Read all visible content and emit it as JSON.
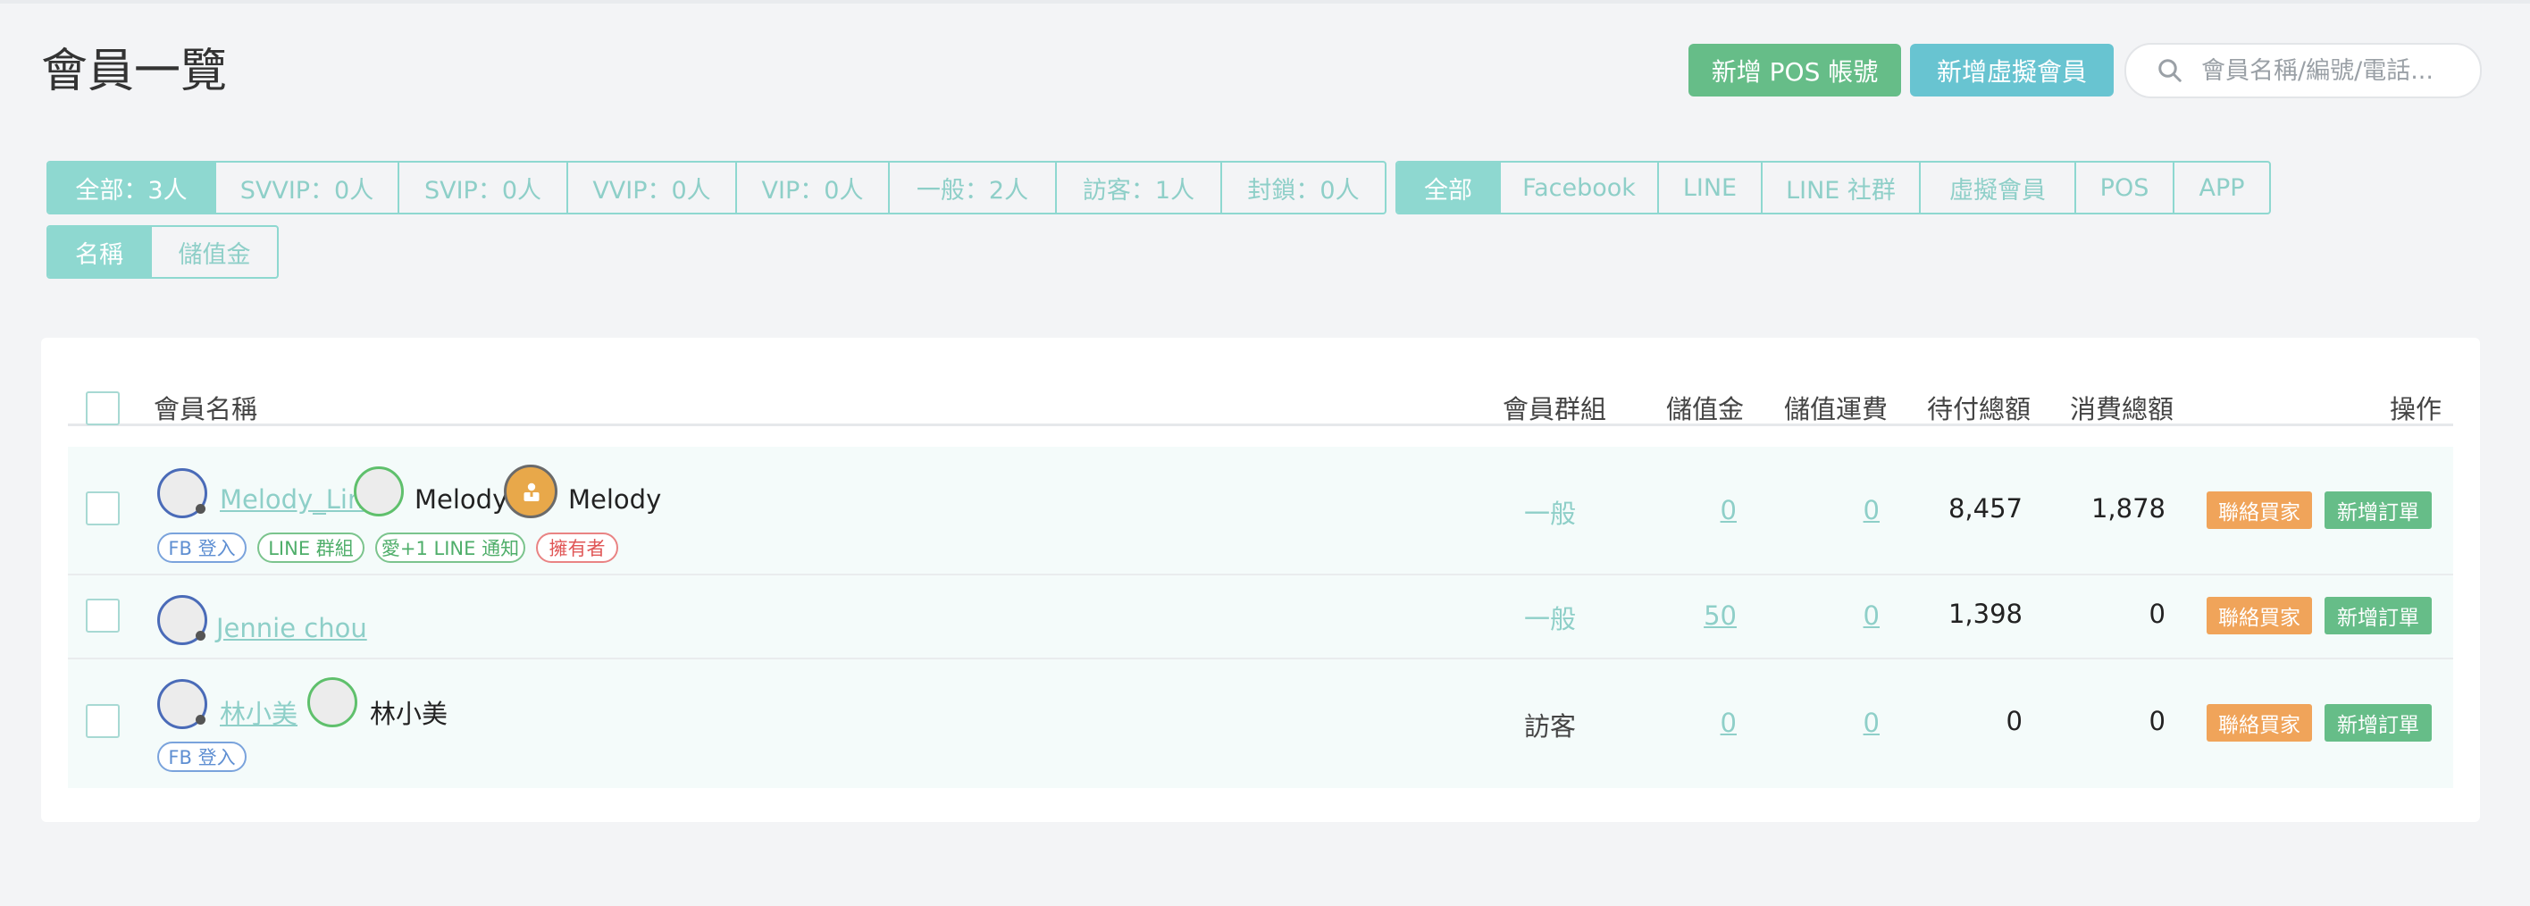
{
  "header": {
    "title": "會員一覽",
    "add_pos_button": "新增 POS 帳號",
    "add_virtual_button": "新增虛擬會員",
    "search_placeholder": "會員名稱/編號/電話..."
  },
  "level_tabs": [
    {
      "label": "全部：3人",
      "active": true
    },
    {
      "label": "SVVIP：0人",
      "active": false
    },
    {
      "label": "SVIP：0人",
      "active": false
    },
    {
      "label": "VVIP：0人",
      "active": false
    },
    {
      "label": "VIP：0人",
      "active": false
    },
    {
      "label": "一般：2人",
      "active": false
    },
    {
      "label": "訪客：1人",
      "active": false
    },
    {
      "label": "封鎖：0人",
      "active": false
    }
  ],
  "source_tabs": [
    {
      "label": "全部",
      "active": true
    },
    {
      "label": "Facebook",
      "active": false
    },
    {
      "label": "LINE",
      "active": false
    },
    {
      "label": "LINE 社群",
      "active": false
    },
    {
      "label": "虛擬會員",
      "active": false
    },
    {
      "label": "POS",
      "active": false
    },
    {
      "label": "APP",
      "active": false
    }
  ],
  "sort_tabs": [
    {
      "label": "名稱",
      "active": true
    },
    {
      "label": "儲值金",
      "active": false
    }
  ],
  "table": {
    "headers": {
      "name": "會員名稱",
      "group": "會員群組",
      "stored_value": "儲值金",
      "stored_shipping": "儲值運費",
      "pending_total": "待付總額",
      "spent_total": "消費總額",
      "actions": "操作"
    },
    "rows": [
      {
        "fb_name": "Melody_Lin",
        "line_name": "Melody",
        "owner_name": "Melody",
        "badges": [
          "FB 登入",
          "LINE 群組",
          "愛+1 LINE 通知",
          "擁有者"
        ],
        "group": "一般",
        "stored_value": "0",
        "stored_shipping": "0",
        "pending_total": "8,457",
        "spent_total": "1,878",
        "contact_label": "聯絡買家",
        "order_label": "新增訂單"
      },
      {
        "fb_name": "Jennie chou",
        "group": "一般",
        "stored_value": "50",
        "stored_shipping": "0",
        "pending_total": "1,398",
        "spent_total": "0",
        "contact_label": "聯絡買家",
        "order_label": "新增訂單"
      },
      {
        "fb_name": "林小美",
        "line_name": "林小美",
        "badges": [
          "FB 登入"
        ],
        "group": "訪客",
        "stored_value": "0",
        "stored_shipping": "0",
        "pending_total": "0",
        "spent_total": "0",
        "contact_label": "聯絡買家",
        "order_label": "新增訂單"
      }
    ]
  },
  "colors": {
    "teal": "#8ed8d0",
    "green_button": "#66bd88",
    "cyan_button": "#68c4d1",
    "orange_button": "#f0a45a"
  }
}
